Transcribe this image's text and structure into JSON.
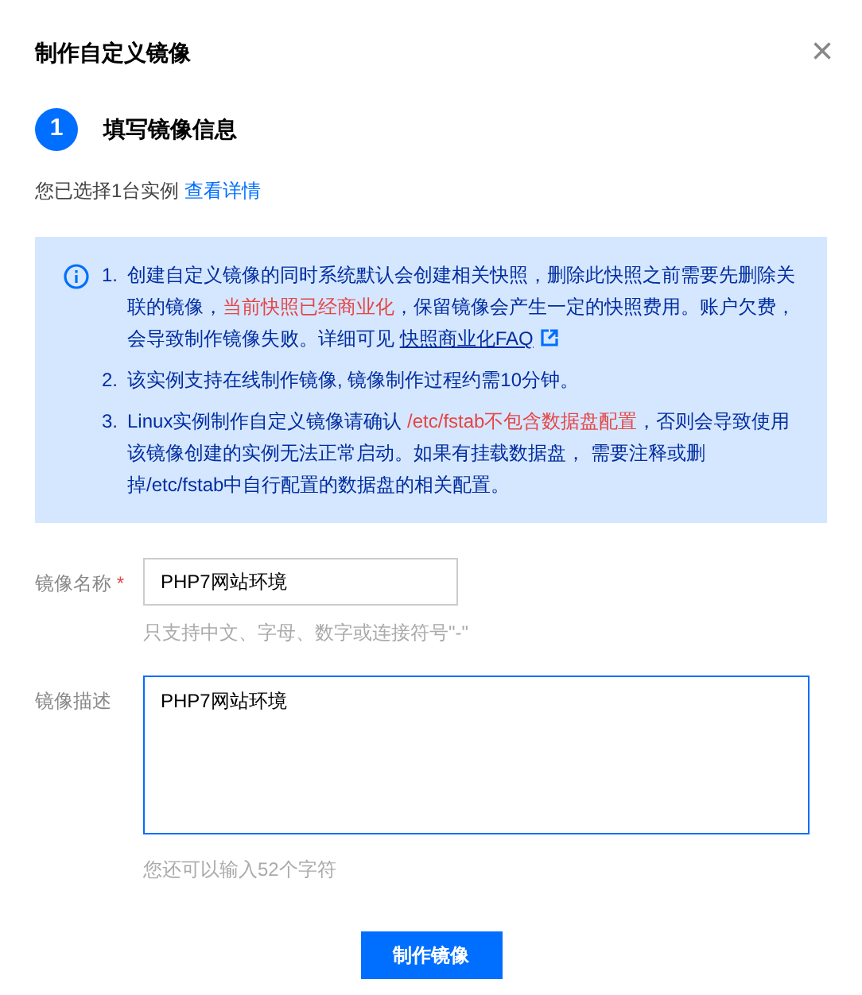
{
  "dialog": {
    "title": "制作自定义镜像",
    "close": "×"
  },
  "step": {
    "number": "1",
    "label": "填写镜像信息"
  },
  "selection": {
    "text": "您已选择1台实例",
    "link": "查看详情"
  },
  "notice": {
    "items": [
      {
        "marker": "1.",
        "parts": [
          {
            "kind": "text",
            "text": "创建自定义镜像的同时系统默认会创建相关快照，删除此快照之前需要先删除关联的镜像，"
          },
          {
            "kind": "warning",
            "text": "当前快照已经商业化"
          },
          {
            "kind": "text",
            "text": "，保留镜像会产生一定的快照费用。账户欠费，会导致制作镜像失败。详细可见 "
          },
          {
            "kind": "link",
            "text": "快照商业化FAQ"
          }
        ]
      },
      {
        "marker": "2.",
        "parts": [
          {
            "kind": "text",
            "text": "该实例支持在线制作镜像, 镜像制作过程约需10分钟。"
          }
        ]
      },
      {
        "marker": "3.",
        "parts": [
          {
            "kind": "text",
            "text": "Linux实例制作自定义镜像请确认 "
          },
          {
            "kind": "warning",
            "text": "/etc/fstab不包含数据盘配置"
          },
          {
            "kind": "text",
            "text": "，否则会导致使用该镜像创建的实例无法正常启动。如果有挂载数据盘， 需要注释或删掉/etc/fstab中自行配置的数据盘的相关配置。"
          }
        ]
      }
    ]
  },
  "fields": [
    {
      "kind": "input",
      "label": "镜像名称",
      "required": true,
      "required_mark": "*",
      "value": "PHP7网站环境",
      "hint": "只支持中文、字母、数字或连接符号\"-\"",
      "focused": false
    },
    {
      "kind": "textarea",
      "label": "镜像描述",
      "required": false,
      "value": "PHP7网站环境",
      "hint": "您还可以输入52个字符",
      "focused": true
    }
  ],
  "submit": "制作镜像"
}
